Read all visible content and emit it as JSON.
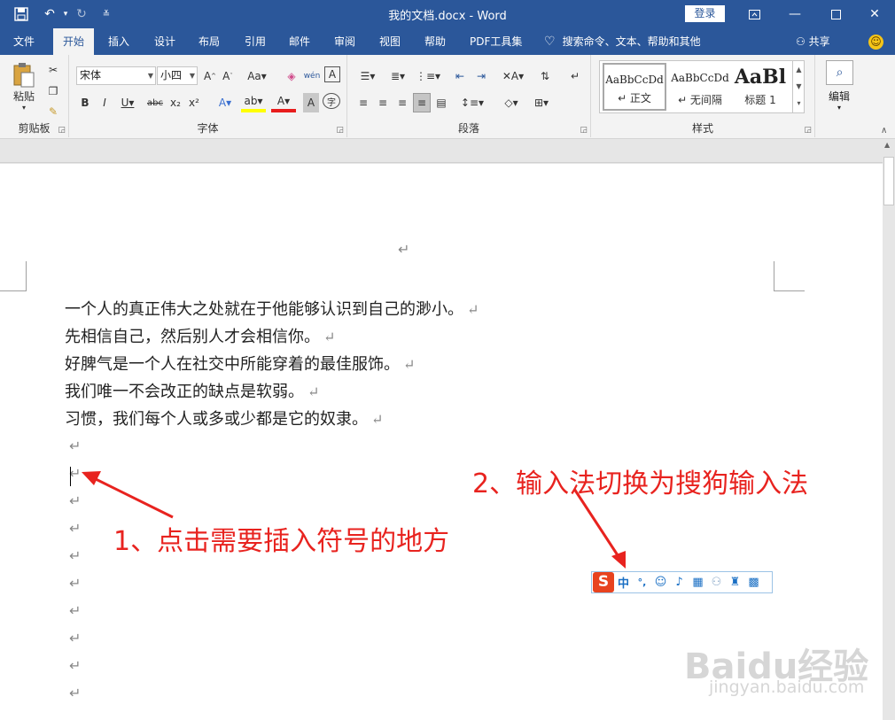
{
  "titlebar": {
    "title": "我的文档.docx  -  Word",
    "login": "登录",
    "bg_color": "#2b579a"
  },
  "quick_access": {
    "save_icon": "save-icon",
    "undo_icon": "undo-icon",
    "redo_icon": "redo-icon",
    "customize_icon": "customize-icon"
  },
  "tabs": [
    {
      "label": "文件"
    },
    {
      "label": "开始"
    },
    {
      "label": "插入"
    },
    {
      "label": "设计"
    },
    {
      "label": "布局"
    },
    {
      "label": "引用"
    },
    {
      "label": "邮件"
    },
    {
      "label": "审阅"
    },
    {
      "label": "视图"
    },
    {
      "label": "帮助"
    },
    {
      "label": "PDF工具集"
    }
  ],
  "active_tab": "开始",
  "tell_me": "搜索命令、文本、帮助和其他",
  "share": "共享",
  "ribbon": {
    "clipboard": {
      "paste": "粘贴",
      "label": "剪贴板"
    },
    "font": {
      "name": "宋体",
      "size": "小四",
      "label": "字体"
    },
    "paragraph": {
      "label": "段落"
    },
    "styles": {
      "label": "样式",
      "items": [
        {
          "sample": "AaBbCcDd",
          "name": "↵ 正文"
        },
        {
          "sample": "AaBbCcDd",
          "name": "↵ 无间隔"
        },
        {
          "sample": "AaBl",
          "name": "标题 1"
        }
      ]
    },
    "editing": {
      "label": "编辑"
    }
  },
  "document": {
    "lines": [
      "一个人的真正伟大之处就在于他能够认识到自己的渺小。",
      "先相信自己，然后别人才会相信你。",
      "好脾气是一个人在社交中所能穿着的最佳服饰。",
      "我们唯一不会改正的缺点是软弱。",
      "习惯，我们每个人或多或少都是它的奴隶。"
    ],
    "para_mark": "↵"
  },
  "annotations": {
    "step1": "1、点击需要插入符号的地方",
    "step2": "2、输入法切换为搜狗输入法",
    "color": "#e8231f"
  },
  "ime": {
    "logo": "S",
    "mode": "中",
    "punct": "°,",
    "icons": [
      "emoji-icon",
      "microphone-icon",
      "keyboard-icon",
      "user-icon",
      "skin-icon",
      "toolbox-icon"
    ]
  },
  "watermark": {
    "brand": "Baidu经验",
    "url": "jingyan.baidu.com"
  }
}
